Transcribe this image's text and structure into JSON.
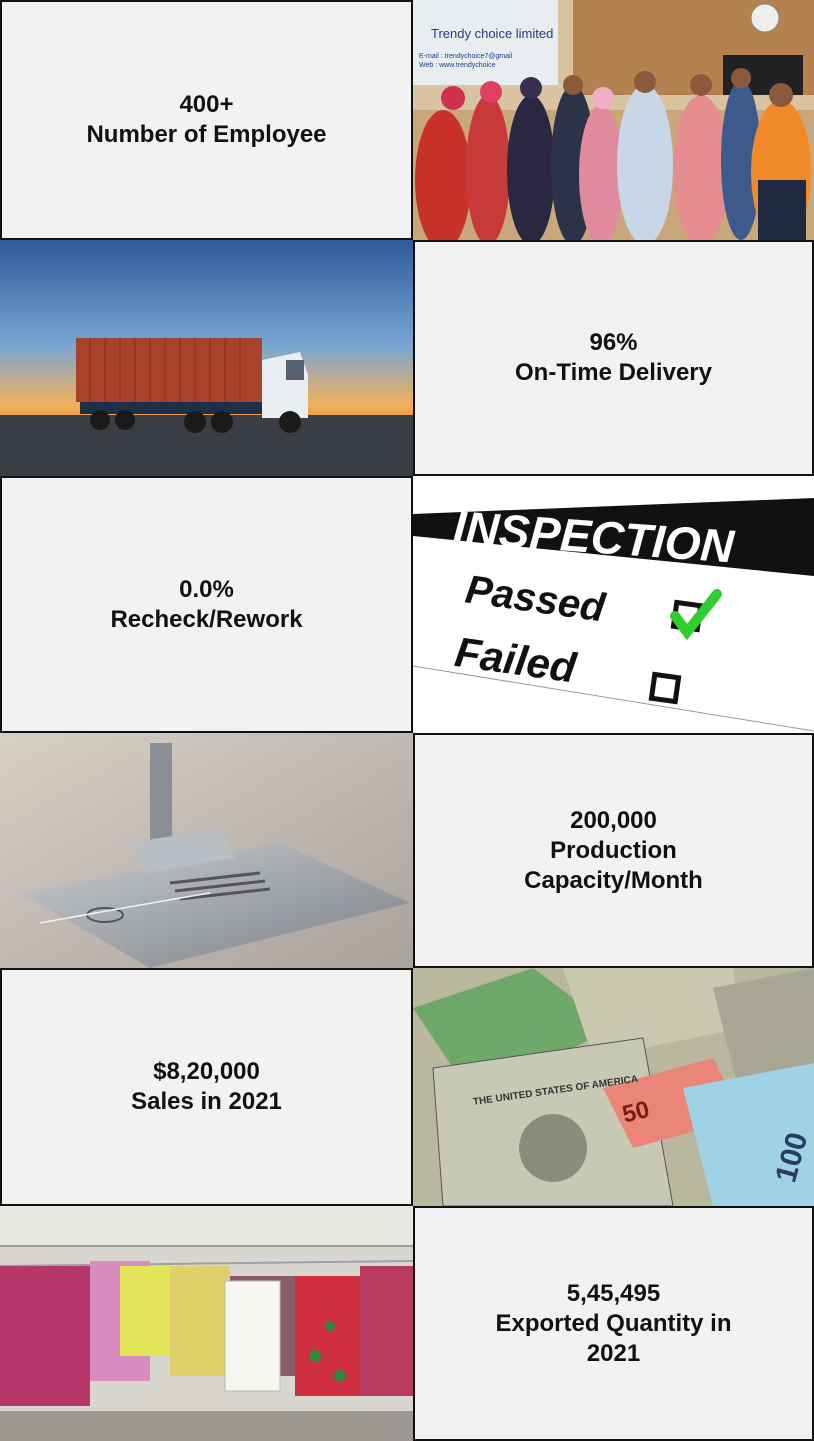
{
  "stats": [
    {
      "value": "400+",
      "label": "Number of Employee"
    },
    {
      "value": "96%",
      "label": "On-Time Delivery"
    },
    {
      "value": "0.0%",
      "label": "Recheck/Rework"
    },
    {
      "value": "200,000",
      "label_line1": "Production",
      "label_line2": "Capacity/Month"
    },
    {
      "value": "$8,20,000",
      "label": "Sales in 2021"
    },
    {
      "value": "5,45,495",
      "label_line1": "Exported Quantity in",
      "label_line2": "2021"
    }
  ],
  "images": {
    "team": {
      "sign_company": "Trendy choice limited",
      "sign_email": "E-mail : trendychoice7@gmail",
      "sign_web": "Web    : www.trendychoice"
    },
    "inspection": {
      "heading": "INSPECTION",
      "passed": "Passed",
      "failed": "Failed"
    },
    "money": {
      "text_50": "50",
      "text_100": "100",
      "text_bill": "THE UNITED STATES OF AMERICA"
    }
  },
  "colors": {
    "cell_bg": "#f2f2f2",
    "border": "#111111",
    "check_green": "#2fcf2f"
  }
}
